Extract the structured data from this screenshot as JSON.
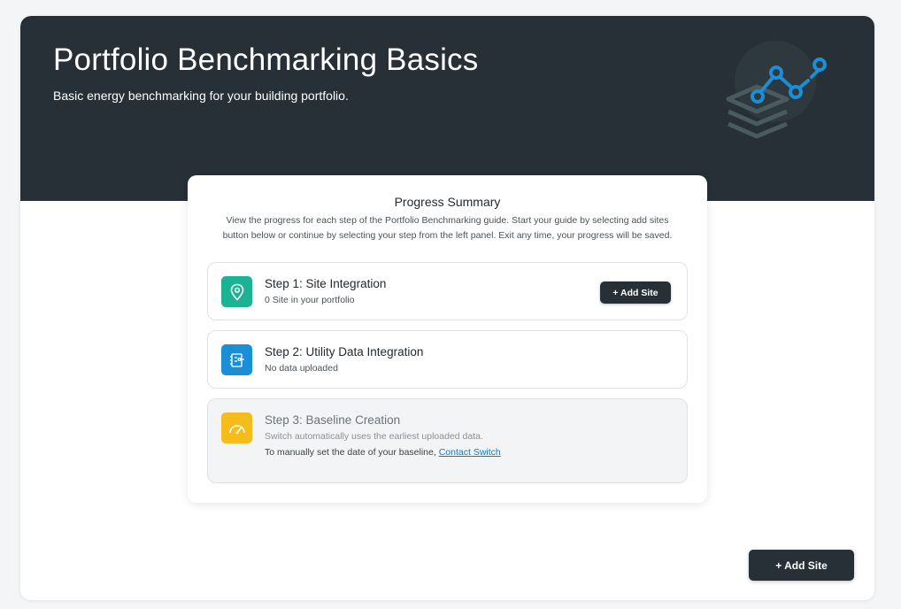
{
  "header": {
    "title": "Portfolio Benchmarking Basics",
    "subtitle": "Basic energy benchmarking for your building portfolio.",
    "illustration_icon": "layers-chart-icon"
  },
  "summary": {
    "title": "Progress Summary",
    "description": "View the progress for each step of the Portfolio Benchmarking guide. Start your guide by selecting add sites button below or continue by selecting your step from the left panel. Exit any time, your progress will be saved."
  },
  "steps": [
    {
      "title": "Step 1: Site Integration",
      "subtitle": "0 Site in your portfolio",
      "icon": "location-pin-icon",
      "icon_color": "#1bb394",
      "button_label": "+ Add Site"
    },
    {
      "title": "Step 2: Utility Data Integration",
      "subtitle": "No data uploaded",
      "icon": "data-integration-icon",
      "icon_color": "#1a8fd6"
    },
    {
      "title": "Step 3: Baseline Creation",
      "subtitle": "Switch automatically uses the earliest uploaded data.",
      "note_text": "To manually set the date of your baseline,",
      "note_link": "Contact Switch",
      "icon": "gauge-icon",
      "icon_color": "#f5bc1c"
    }
  ],
  "footer": {
    "add_site_label": "+ Add Site"
  },
  "colors": {
    "hero_bg": "#263036",
    "accent_blue": "#1a8fd6",
    "link": "#1578c8"
  }
}
